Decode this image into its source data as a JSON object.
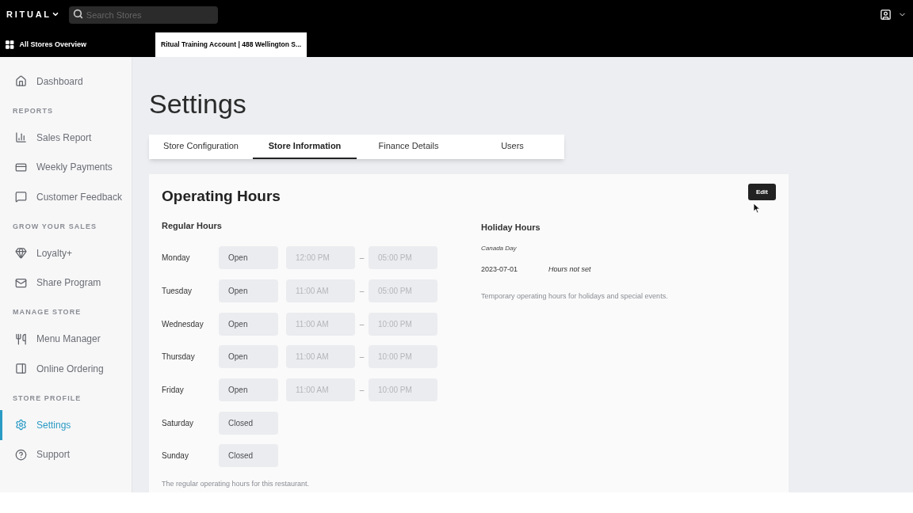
{
  "topbar": {
    "logo": "RITUAL",
    "search": {
      "placeholder": "Search Stores"
    }
  },
  "store_tabs": [
    {
      "label": "All Stores Overview",
      "selected": false
    },
    {
      "label": "Ritual Training Account | 488 Wellington S...",
      "selected": true
    }
  ],
  "sidebar": {
    "items": [
      {
        "kind": "item",
        "label": "Dashboard",
        "selected": false
      },
      {
        "kind": "section",
        "label": "REPORTS"
      },
      {
        "kind": "item",
        "label": "Sales Report",
        "selected": false
      },
      {
        "kind": "item",
        "label": "Weekly Payments",
        "selected": false
      },
      {
        "kind": "item",
        "label": "Customer Feedback",
        "selected": false
      },
      {
        "kind": "section",
        "label": "GROW YOUR SALES"
      },
      {
        "kind": "item",
        "label": "Loyalty+",
        "selected": false
      },
      {
        "kind": "item",
        "label": "Share Program",
        "selected": false
      },
      {
        "kind": "section",
        "label": "MANAGE STORE"
      },
      {
        "kind": "item",
        "label": "Menu Manager",
        "selected": false
      },
      {
        "kind": "item",
        "label": "Online Ordering",
        "selected": false
      },
      {
        "kind": "section",
        "label": "STORE PROFILE"
      },
      {
        "kind": "item",
        "label": "Settings",
        "selected": true
      },
      {
        "kind": "item",
        "label": "Support",
        "selected": false
      }
    ]
  },
  "page_title": "Settings",
  "tabs": [
    {
      "label": "Store Configuration",
      "selected": false
    },
    {
      "label": "Store Information",
      "selected": true
    },
    {
      "label": "Finance Details",
      "selected": false
    },
    {
      "label": "Users",
      "selected": false
    }
  ],
  "card": {
    "title": "Operating Hours",
    "edit_button": "Edit",
    "regular_hours": {
      "title": "Regular Hours",
      "days": [
        {
          "day": "Monday",
          "status": "Open",
          "open_time": "12:00 PM",
          "close_time": "05:00 PM"
        },
        {
          "day": "Tuesday",
          "status": "Open",
          "open_time": "11:00 AM",
          "close_time": "05:00 PM"
        },
        {
          "day": "Wednesday",
          "status": "Open",
          "open_time": "11:00 AM",
          "close_time": "10:00 PM"
        },
        {
          "day": "Thursday",
          "status": "Open",
          "open_time": "11:00 AM",
          "close_time": "10:00 PM"
        },
        {
          "day": "Friday",
          "status": "Open",
          "open_time": "11:00 AM",
          "close_time": "10:00 PM"
        },
        {
          "day": "Saturday",
          "status": "Closed"
        },
        {
          "day": "Sunday",
          "status": "Closed"
        }
      ],
      "separator": "–",
      "note": "The regular operating hours for this restaurant."
    },
    "holiday_hours": {
      "title": "Holiday Hours",
      "holidays": [
        {
          "name": "Canada Day",
          "date": "2023-07-01",
          "hours": "Hours not set"
        }
      ],
      "note": "Temporary operating hours for holidays and special events."
    }
  }
}
